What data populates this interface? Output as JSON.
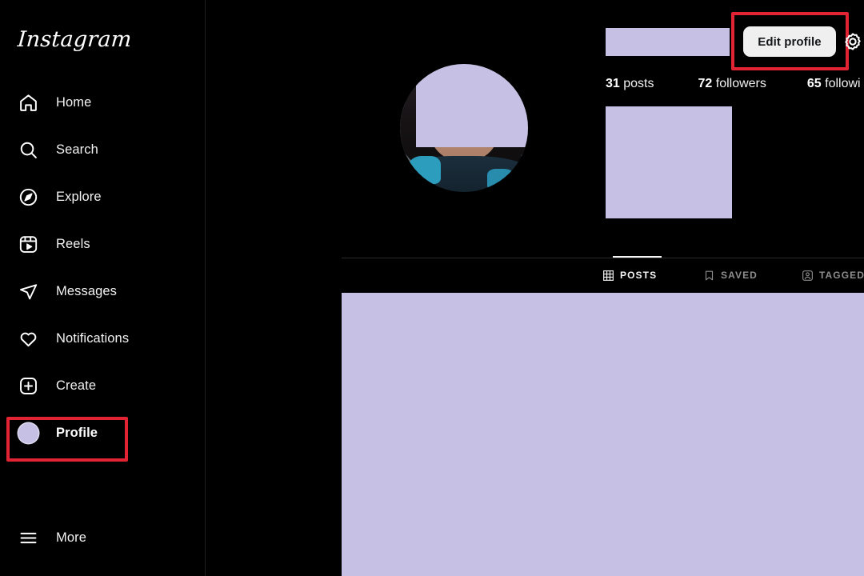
{
  "app": {
    "brand": "Instagram",
    "theme": "dark",
    "background_color": "#000000",
    "accent_annotation_color": "#e12334",
    "redaction_color": "#c6c1e4"
  },
  "sidebar": {
    "items": [
      {
        "label": "Home",
        "icon": "home-icon",
        "active": false
      },
      {
        "label": "Search",
        "icon": "search-icon",
        "active": false
      },
      {
        "label": "Explore",
        "icon": "compass-icon",
        "active": false
      },
      {
        "label": "Reels",
        "icon": "reels-icon",
        "active": false
      },
      {
        "label": "Messages",
        "icon": "paper-plane-icon",
        "active": false
      },
      {
        "label": "Notifications",
        "icon": "heart-icon",
        "active": false
      },
      {
        "label": "Create",
        "icon": "plus-square-icon",
        "active": false
      },
      {
        "label": "Profile",
        "icon": "profile-avatar-icon",
        "active": true
      }
    ],
    "more": {
      "label": "More",
      "icon": "hamburger-menu-icon"
    }
  },
  "profile": {
    "username_redacted": true,
    "avatar_redacted": true,
    "edit_profile_label": "Edit profile",
    "settings_icon": "gear-icon",
    "stats": [
      {
        "count": "31",
        "label": "posts"
      },
      {
        "count": "72",
        "label": "followers"
      },
      {
        "count": "65",
        "label": "followi"
      }
    ],
    "bio_redacted": true
  },
  "tabs": [
    {
      "label": "POSTS",
      "icon": "grid-icon",
      "active": true
    },
    {
      "label": "SAVED",
      "icon": "bookmark-icon",
      "active": false
    },
    {
      "label": "TAGGED",
      "icon": "tagged-person-icon",
      "active": false
    }
  ],
  "content": {
    "redacted": true
  }
}
